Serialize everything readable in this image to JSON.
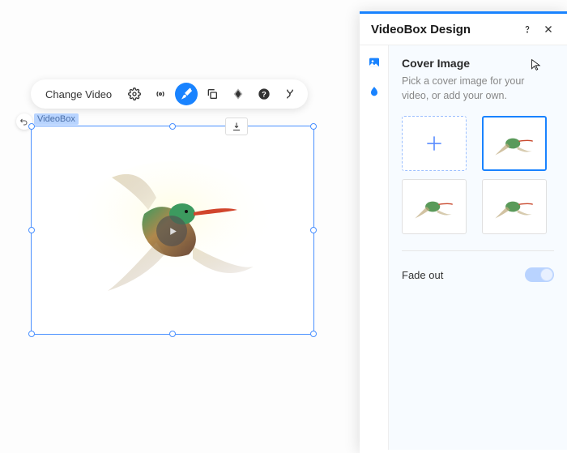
{
  "toolbar": {
    "change_label": "Change Video"
  },
  "tag_label": "VideoBox",
  "panel": {
    "title": "VideoBox Design",
    "section_title": "Cover Image",
    "section_desc": "Pick a cover image for your video, or add your own.",
    "fade_out_label": "Fade out"
  }
}
